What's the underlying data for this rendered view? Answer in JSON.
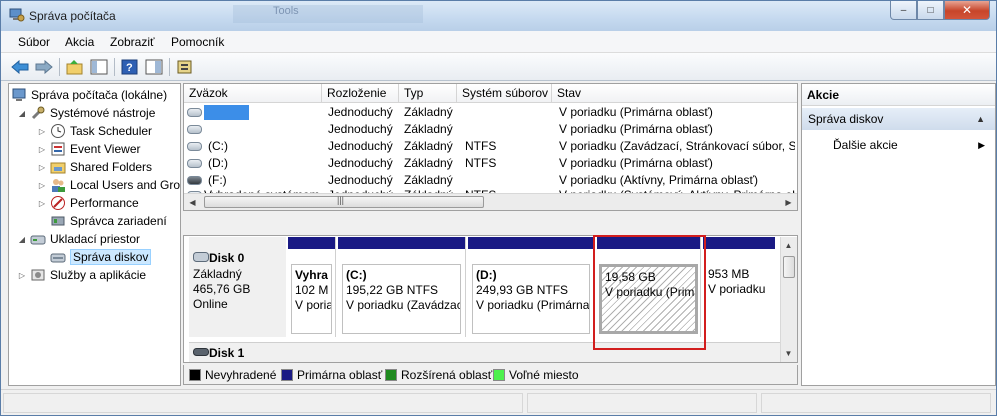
{
  "window": {
    "title": "Správa počítača",
    "ghost_text": "Tools"
  },
  "window_buttons": {
    "minimize": "–",
    "maximize": "□",
    "close": "✕"
  },
  "menu": [
    "Súbor",
    "Akcia",
    "Zobraziť",
    "Pomocník"
  ],
  "toolbar": {
    "icons": [
      "back-arrow-icon",
      "forward-arrow-icon",
      "up-folder-icon",
      "show-hide-tree-icon",
      "help-icon",
      "properties-icon",
      "settings-icon"
    ]
  },
  "tree": {
    "root": "Správa počítača (lokálne)",
    "system_tools": "Systémové nástroje",
    "task_scheduler": "Task Scheduler",
    "event_viewer": "Event Viewer",
    "shared_folders": "Shared Folders",
    "local_users": "Local Users and Gro",
    "performance": "Performance",
    "device_manager": "Správca zariadení",
    "storage": "Ukladací priestor",
    "disk_management": "Správa diskov",
    "services": "Služby a aplikácie"
  },
  "volumes": {
    "headers": [
      "Zväzok",
      "Rozloženie",
      "Typ",
      "Systém súborov",
      "Stav"
    ],
    "rows": [
      {
        "name": "",
        "layout": "Jednoduchý",
        "type": "Základný",
        "fs": "",
        "status": "V poriadku (Primárna oblasť)"
      },
      {
        "name": "",
        "layout": "Jednoduchý",
        "type": "Základný",
        "fs": "",
        "status": "V poriadku (Primárna oblasť)"
      },
      {
        "name": "(C:)",
        "layout": "Jednoduchý",
        "type": "Základný",
        "fs": "NTFS",
        "status": "V poriadku (Zavádzací, Stránkovací súbor, Sta"
      },
      {
        "name": "(D:)",
        "layout": "Jednoduchý",
        "type": "Základný",
        "fs": "NTFS",
        "status": "V poriadku (Primárna oblasť)"
      },
      {
        "name": "(F:)",
        "layout": "Jednoduchý",
        "type": "Základný",
        "fs": "",
        "status": "V poriadku (Aktívny, Primárna oblasť)"
      },
      {
        "name": "Vyhradené systémom",
        "layout": "Jednoduchý",
        "type": "Základný",
        "fs": "NTFS",
        "status": "V poriadku (Systémový, Aktívny, Primárna ob"
      }
    ],
    "scroll_glyph": "|||"
  },
  "disk0": {
    "name": "Disk 0",
    "type": "Základný",
    "size": "465,76 GB",
    "status": "Online",
    "partitions": [
      {
        "title": "Vyhra",
        "size": "102 M",
        "status": "V poria"
      },
      {
        "title": "(C:)",
        "size": "195,22 GB NTFS",
        "status": "V poriadku (Zavádzac"
      },
      {
        "title": "(D:)",
        "size": "249,93 GB NTFS",
        "status": "V poriadku (Primárna"
      },
      {
        "title": "",
        "size": "19,58 GB",
        "status": "V poriadku (Prim"
      },
      {
        "title": "",
        "size": "953 MB",
        "status": "V poriadku"
      }
    ]
  },
  "disk1": {
    "name": "Disk 1"
  },
  "legend": [
    {
      "label": "Nevyhradené",
      "color": "#000000"
    },
    {
      "label": "Primárna oblasť",
      "color": "#1a1a84"
    },
    {
      "label": "Rozšírená oblasť",
      "color": "#1f8a1f"
    },
    {
      "label": "Voľné miesto",
      "color": "#4cf04c"
    }
  ],
  "actions": {
    "header": "Akcie",
    "section": "Správa diskov",
    "more": "Ďalšie akcie"
  }
}
